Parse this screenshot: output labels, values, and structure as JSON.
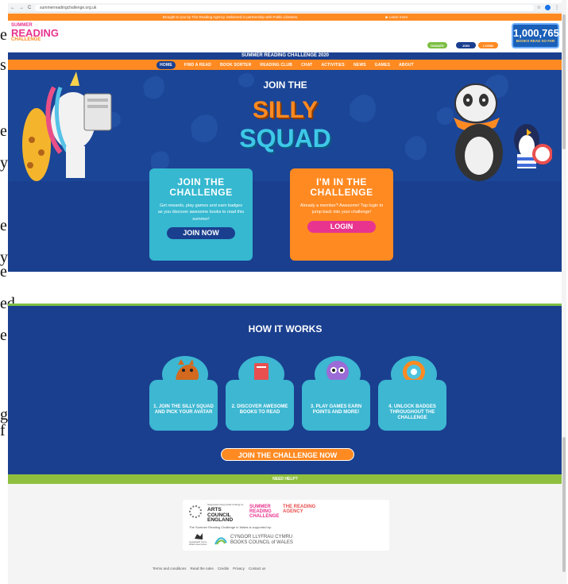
{
  "browser": {
    "url": "summerreadingchallenge.org.uk",
    "back": "←",
    "forward": "→",
    "reload": "C",
    "star": "☆",
    "menu": "⋮"
  },
  "margin_letters": [
    "e",
    "s",
    "e",
    "y",
    "e",
    "y",
    "e",
    "ed",
    "e",
    "g",
    "f"
  ],
  "promo": {
    "text": "Brought to you by The Reading Agency. Delivered in partnership with Public Libraries.",
    "learn_more": "▶ Learn more"
  },
  "logo": {
    "line1": "SUMMER",
    "line2": "READING",
    "line3": "CHALLENGE"
  },
  "header_buttons": {
    "donate": "DONATE",
    "join": "JOIN",
    "login": "LOGIN"
  },
  "counter": {
    "number": "1,000,765",
    "caption": "BOOKS READ SO FAR"
  },
  "nav": {
    "title": "SUMMER READING CHALLENGE 2020",
    "items": [
      "HOME",
      "FIND A READ",
      "BOOK SORTER",
      "READING CLUB",
      "CHAT",
      "ACTIVITIES",
      "NEWS",
      "GAMES",
      "ABOUT"
    ]
  },
  "hero": {
    "join": "JOIN THE",
    "silly": "SILLY",
    "squad": "SQUAD"
  },
  "card_join": {
    "title1": "JOIN THE",
    "title2": "CHALLENGE",
    "text": "Get rewards, play games and earn badges as you discover awesome books to read this summer!",
    "button": "JOIN NOW"
  },
  "card_login": {
    "title1": "I'M IN THE",
    "title2": "CHALLENGE",
    "text": "Already a member? Awesome! Tap login to jump back into your challenge!",
    "button": "LOGIN"
  },
  "how": {
    "title": "HOW IT WORKS",
    "steps": [
      "1. JOIN THE SILLY SQUAD AND PICK YOUR AVATAR",
      "2. DISCOVER AWESOME BOOKS TO READ",
      "3. PLAY GAMES EARN POINTS AND MORE!",
      "4. UNLOCK BADGES THROUGHOUT THE CHALLENGE"
    ],
    "cta": "JOIN THE CHALLENGE NOW"
  },
  "help": "NEED HELP?",
  "sponsors": {
    "arts_caption": "Supported using public funding by",
    "arts_name": "ARTS COUNCIL ENGLAND",
    "src_name": "SUMMER READING CHALLENGE",
    "tra_name": "THE READING AGENCY",
    "wales_text": "The Summer Reading Challenge in Wales is supported by:",
    "welsh_gov": "Llywodraeth Cymru Welsh Government",
    "books_council_cy": "CYNGOR LLYFRAU CYMRU",
    "books_council_en": "BOOKS COUNCIL of WALES"
  },
  "footer_links": [
    "Terms and conditions",
    "Read the rules",
    "Credits",
    "Privacy",
    "Contact us"
  ]
}
